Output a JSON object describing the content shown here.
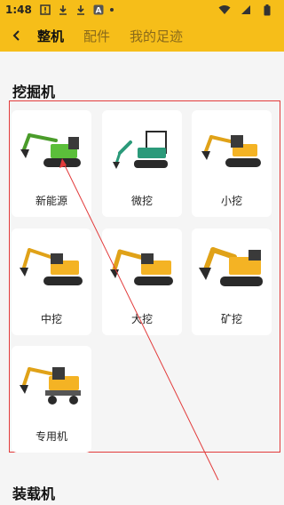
{
  "status": {
    "time": "1:48"
  },
  "header": {
    "tabs": [
      "整机",
      "配件",
      "我的足迹"
    ]
  },
  "sections": {
    "excavator_title": "挖掘机",
    "loader_title": "装载机"
  },
  "categories": [
    {
      "label": "新能源",
      "color": "#5bbf3a"
    },
    {
      "label": "微挖",
      "color": "#2b9a7a"
    },
    {
      "label": "小挖",
      "color": "#f4b324"
    },
    {
      "label": "中挖",
      "color": "#f4b324"
    },
    {
      "label": "大挖",
      "color": "#f4b324"
    },
    {
      "label": "矿挖",
      "color": "#f4b324"
    },
    {
      "label": "专用机",
      "color": "#f4b324"
    }
  ],
  "accent": "#f6be19",
  "annotation_color": "#e23b3b"
}
